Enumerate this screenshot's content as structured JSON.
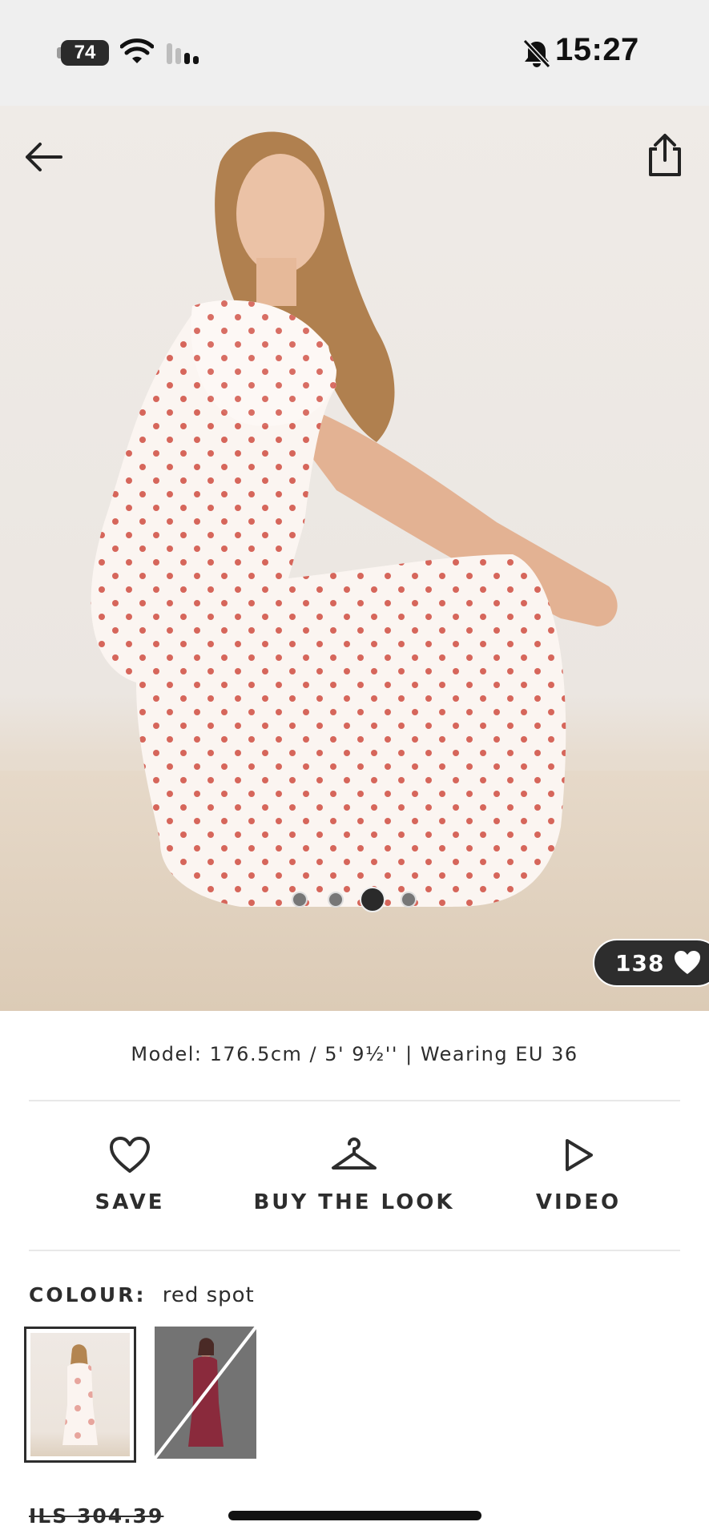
{
  "status_bar": {
    "battery": "74",
    "time": "15:27"
  },
  "hero": {
    "carousel": {
      "total": 4,
      "active_index": 2
    },
    "likes": "138"
  },
  "product": {
    "model_info": "Model: 176.5cm / 5' 9½'' | Wearing EU 36",
    "actions": {
      "save": "SAVE",
      "buy_the_look": "BUY THE LOOK",
      "video": "VIDEO"
    },
    "colour_label": "COLOUR:",
    "colour_value": "red spot",
    "swatches": [
      {
        "name": "red spot",
        "selected": true,
        "available": true
      },
      {
        "name": "red",
        "selected": false,
        "available": false
      }
    ],
    "price": "ILS 304.39"
  },
  "colors": {
    "accent_dark": "#2d2d2d",
    "dot_red": "#d2564a",
    "background": "#ffffff"
  }
}
